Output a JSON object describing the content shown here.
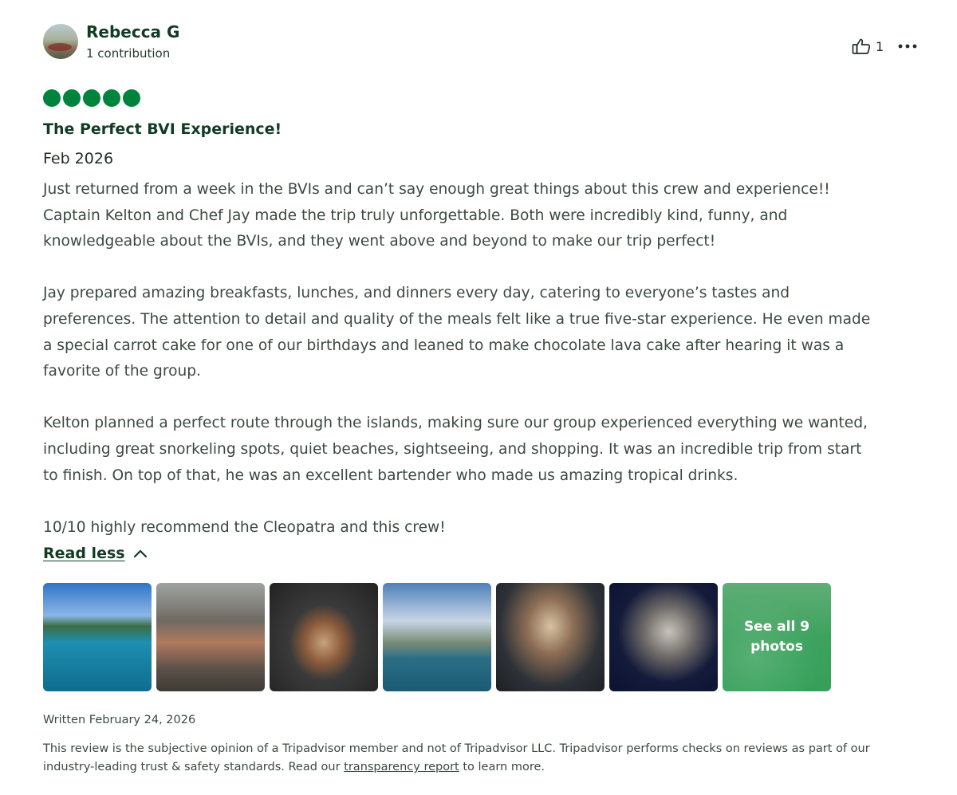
{
  "review": {
    "author": {
      "name": "Rebecca G",
      "contributions": "1 contribution"
    },
    "helpful_count": "1",
    "rating": 5,
    "rating_color": "#00843d",
    "title": "The Perfect BVI Experience!",
    "visit_date": "Feb 2026",
    "paragraphs": [
      [
        "Just returned from a week in the BVIs and can’t say enough great things about this crew and experience!!",
        "Captain Kelton and Chef Jay made the trip truly unforgettable. Both were incredibly kind, funny, and",
        "knowledgeable about the BVIs, and they went above and beyond to make our trip perfect!"
      ],
      [
        "Jay prepared amazing breakfasts, lunches, and dinners every day, catering to everyone’s tastes and",
        "preferences. The attention to detail and quality of the meals felt like a true five-star experience. He even made",
        "a special carrot cake for one of our birthdays and leaned to make chocolate lava cake after hearing it was a",
        "favorite of the group."
      ],
      [
        "Kelton planned a perfect route through the islands, making sure our group experienced everything we wanted,",
        "including great snorkeling spots, quiet beaches, sightseeing, and shopping. It was an incredible trip from start",
        "to finish. On top of that, he was an excellent bartender who made us amazing tropical drinks."
      ],
      [
        "10/10 highly recommend the Cleopatra and this crew!"
      ]
    ],
    "read_less_label": "Read less",
    "photos": [
      {
        "name": "photo-snorkeling-lagoon"
      },
      {
        "name": "photo-group-dinner"
      },
      {
        "name": "photo-plated-meal"
      },
      {
        "name": "photo-catamaran-anchored"
      },
      {
        "name": "photo-birthday-cake"
      },
      {
        "name": "photo-night-group"
      }
    ],
    "see_all_photos_label": "See all 9 photos",
    "written_date": "Written February 24, 2026",
    "disclaimer_text": "This review is the subjective opinion of a Tripadvisor member and not of Tripadvisor LLC. Tripadvisor performs checks on reviews as part of our industry-leading trust & safety standards. Read our ",
    "disclaimer_link": "transparency report",
    "disclaimer_suffix": " to learn more."
  }
}
